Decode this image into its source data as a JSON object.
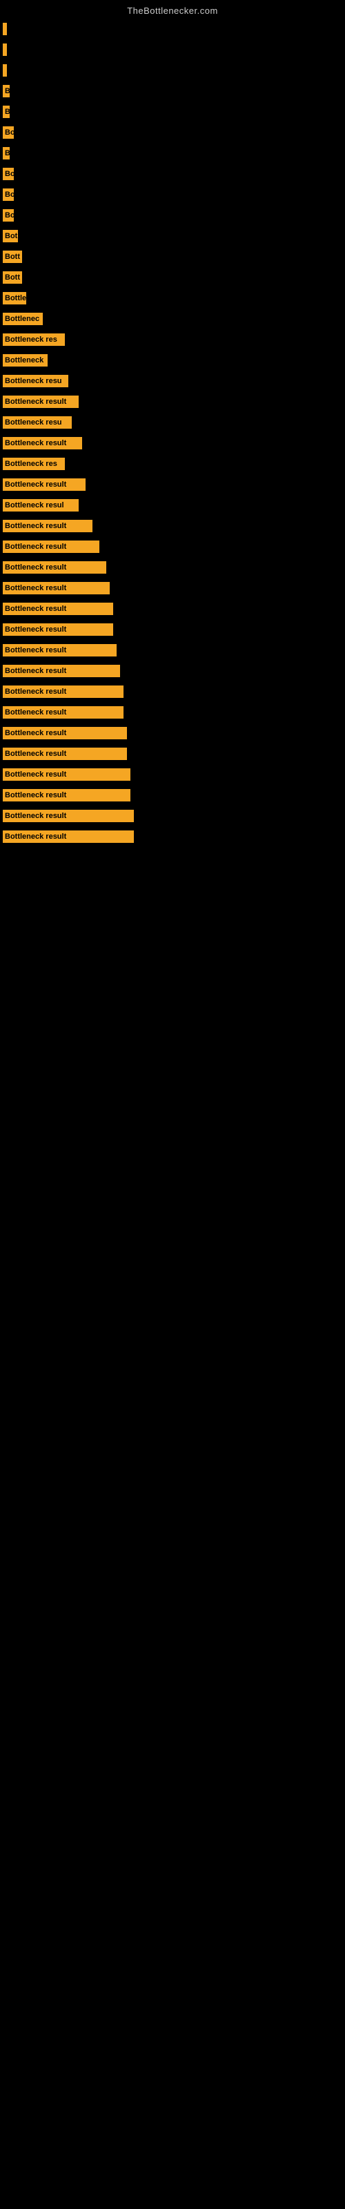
{
  "site_title": "TheBottlenecker.com",
  "bars": [
    {
      "label": "",
      "width": 4
    },
    {
      "label": "",
      "width": 4
    },
    {
      "label": "",
      "width": 4
    },
    {
      "label": "B",
      "width": 10
    },
    {
      "label": "B",
      "width": 10
    },
    {
      "label": "Bo",
      "width": 16
    },
    {
      "label": "B",
      "width": 10
    },
    {
      "label": "Bo",
      "width": 16
    },
    {
      "label": "Bo",
      "width": 16
    },
    {
      "label": "Bo",
      "width": 16
    },
    {
      "label": "Bot",
      "width": 22
    },
    {
      "label": "Bott",
      "width": 28
    },
    {
      "label": "Bott",
      "width": 28
    },
    {
      "label": "Bottle",
      "width": 34
    },
    {
      "label": "Bottlenec",
      "width": 58
    },
    {
      "label": "Bottleneck res",
      "width": 90
    },
    {
      "label": "Bottleneck",
      "width": 65
    },
    {
      "label": "Bottleneck resu",
      "width": 95
    },
    {
      "label": "Bottleneck result",
      "width": 110
    },
    {
      "label": "Bottleneck resu",
      "width": 100
    },
    {
      "label": "Bottleneck result",
      "width": 115
    },
    {
      "label": "Bottleneck res",
      "width": 90
    },
    {
      "label": "Bottleneck result",
      "width": 120
    },
    {
      "label": "Bottleneck resul",
      "width": 110
    },
    {
      "label": "Bottleneck result",
      "width": 130
    },
    {
      "label": "Bottleneck result",
      "width": 140
    },
    {
      "label": "Bottleneck result",
      "width": 150
    },
    {
      "label": "Bottleneck result",
      "width": 155
    },
    {
      "label": "Bottleneck result",
      "width": 160
    },
    {
      "label": "Bottleneck result",
      "width": 160
    },
    {
      "label": "Bottleneck result",
      "width": 165
    },
    {
      "label": "Bottleneck result",
      "width": 170
    },
    {
      "label": "Bottleneck result",
      "width": 175
    },
    {
      "label": "Bottleneck result",
      "width": 175
    },
    {
      "label": "Bottleneck result",
      "width": 180
    },
    {
      "label": "Bottleneck result",
      "width": 180
    },
    {
      "label": "Bottleneck result",
      "width": 185
    },
    {
      "label": "Bottleneck result",
      "width": 185
    },
    {
      "label": "Bottleneck result",
      "width": 190
    },
    {
      "label": "Bottleneck result",
      "width": 190
    }
  ]
}
